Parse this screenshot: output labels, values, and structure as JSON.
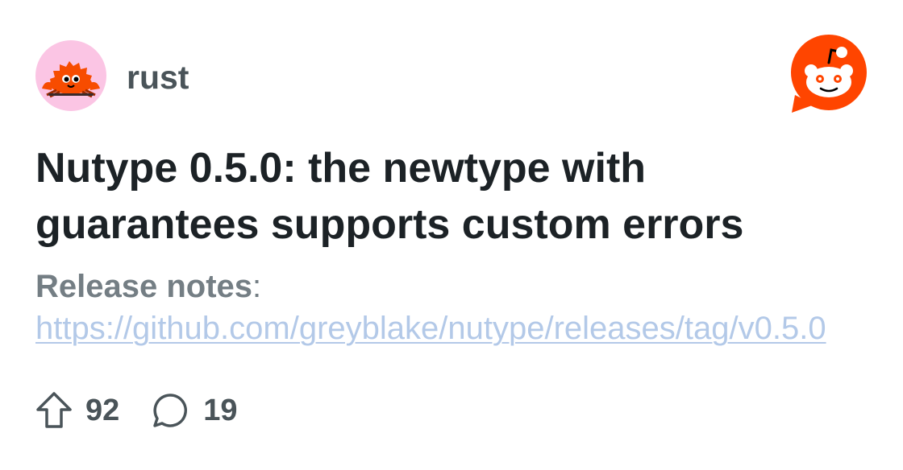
{
  "community": {
    "name": "rust",
    "avatar_icon": "ferris-crab-icon",
    "avatar_bg": "#fbc5e4"
  },
  "brand": {
    "logo_icon": "reddit-logo-icon",
    "color": "#ff4500"
  },
  "post": {
    "title": "Nutype 0.5.0: the newtype with guarantees supports custom errors",
    "body_label": "Release notes",
    "body_separator": ":",
    "link_url": "https://github.com/greyblake/nutype/releases/tag/v0.5.0"
  },
  "stats": {
    "upvotes": "92",
    "upvote_icon": "upvote-arrow-icon",
    "comments": "19",
    "comment_icon": "comment-bubble-icon"
  }
}
